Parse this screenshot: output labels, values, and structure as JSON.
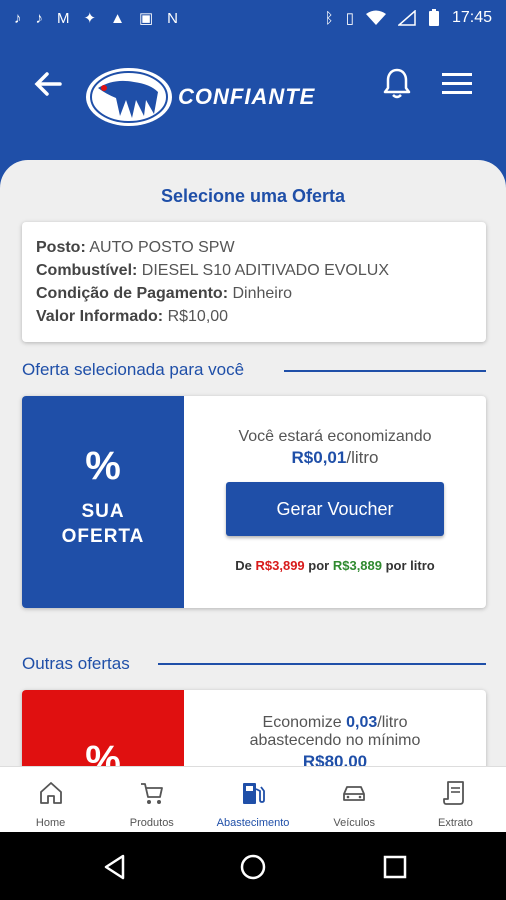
{
  "status_bar": {
    "time": "17:45",
    "left_icons": [
      "tiktok-icon",
      "tiktok-icon",
      "gmail-icon",
      "app-icon",
      "warning-icon",
      "image-icon",
      "app-n-icon"
    ],
    "right_icons": [
      "bluetooth-icon",
      "vibrate-icon",
      "wifi-icon",
      "signal-icon",
      "battery-icon"
    ]
  },
  "header": {
    "brand": "CONFIANTE"
  },
  "page": {
    "title": "Selecione uma Oferta"
  },
  "info": {
    "posto_label": "Posto:",
    "posto_value": " AUTO POSTO SPW",
    "combustivel_label": "Combustível:",
    "combustivel_value": " DIESEL S10 ADITIVADO EVOLUX",
    "pagamento_label": "Condição de Pagamento:",
    "pagamento_value": " Dinheiro",
    "valor_label": "Valor Informado:",
    "valor_value": " R$10,00"
  },
  "selected_offer": {
    "section_label": "Oferta selecionada para você",
    "badge_symbol": "%",
    "badge_text": "SUA OFERTA",
    "saving_text": "Você estará economizando",
    "saving_amount": "R$0,01",
    "saving_unit": "/litro",
    "button_label": "Gerar Voucher",
    "price_prefix": "De ",
    "old_price": "R$3,899",
    "price_middle": " por ",
    "new_price": "R$3,889",
    "price_suffix": " por litro"
  },
  "other_offers": {
    "section_label": "Outras ofertas",
    "badge_symbol": "%",
    "economize_text": "Economize ",
    "economize_amount": "0,03",
    "economize_unit": "/litro",
    "min_text": "abastecendo no mínimo",
    "min_value": "R$80,00"
  },
  "colors": {
    "primary": "#1f4fa8",
    "accent_red": "#e01010",
    "old_price": "#d81b1b",
    "new_price": "#2f8a2f"
  },
  "bottom_nav": {
    "items": [
      {
        "label": "Home",
        "icon": "home-icon"
      },
      {
        "label": "Produtos",
        "icon": "cart-icon"
      },
      {
        "label": "Abastecimento",
        "icon": "fuel-pump-icon"
      },
      {
        "label": "Veículos",
        "icon": "car-icon"
      },
      {
        "label": "Extrato",
        "icon": "receipt-icon"
      }
    ],
    "active_index": 2
  }
}
